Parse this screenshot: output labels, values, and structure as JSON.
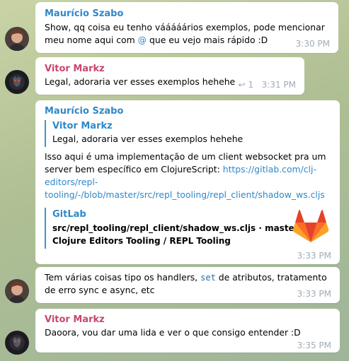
{
  "colors": {
    "author_blue": "#2f88c8",
    "author_pink": "#c8466d",
    "link": "#2f88c8",
    "time": "#a0acb6",
    "quote_bar": "#3a95d1",
    "gitlab_orange": "#e24329"
  },
  "messages": [
    {
      "sender": "Maurício Szabo",
      "lines": [
        "Show, qq coisa eu tenho vááááários exemplos, pode mencionar"
      ],
      "line2_before": "meu nome aqui com ",
      "line2_mention": "@",
      "line2_after": " que eu vejo mais rápido :D",
      "time": "3:30 PM",
      "avatar": "avatar-mauricio"
    },
    {
      "sender": "Vitor Markz",
      "text": "Legal, adoraria ver esses exemplos hehehe",
      "reply_icon": "reply-icon",
      "reply_count": "1",
      "time": "3:31 PM",
      "avatar": "avatar-vitor"
    },
    {
      "sender": "Maurício Szabo",
      "quote_sender": "Vitor Markz",
      "quote_text": "Legal, adoraria ver esses exemplos hehehe",
      "body_lines": [
        "Isso aqui é uma implementação de um client websocket pra um",
        "server bem específico em ClojureScript: "
      ],
      "link_lines": [
        "https://gitlab.com/clj-",
        "editors/repl-",
        "tooling/-/blob/master/src/repl_tooling/repl_client/shadow_ws.cljs"
      ],
      "preview_site": "GitLab",
      "preview_lines": [
        "src/repl_tooling/repl_client/shadow_ws.cljs · master ·",
        "Clojure Editors Tooling / REPL Tooling"
      ],
      "preview_icon": "gitlab-logo-icon",
      "time": "3:33 PM"
    },
    {
      "before_code": "Tem várias coisas tipo os handlers, ",
      "code": "set",
      "after_code": " de atributos, tratamento",
      "line2": "de erro sync e async, etc",
      "time": "3:33 PM",
      "avatar": "avatar-mauricio"
    },
    {
      "sender": "Vitor Markz",
      "text": "Daoora, vou dar uma lida e ver o que consigo entender :D",
      "time": "3:35 PM",
      "avatar": "avatar-vitor"
    }
  ]
}
